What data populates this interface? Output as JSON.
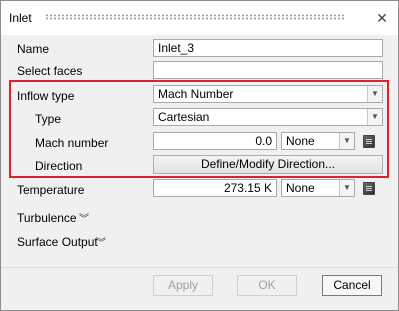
{
  "window": {
    "title": "Inlet"
  },
  "form": {
    "name_label": "Name",
    "name_value": "Inlet_3",
    "select_faces_label": "Select faces",
    "select_faces_value": "",
    "inflow_type_label": "Inflow type",
    "inflow_type_value": "Mach Number",
    "type_label": "Type",
    "type_value": "Cartesian",
    "mach_label": "Mach number",
    "mach_value": "0.0",
    "mach_unit": "None",
    "direction_label": "Direction",
    "direction_button": "Define/Modify Direction...",
    "temperature_label": "Temperature",
    "temperature_value": "273.15 K",
    "temperature_unit": "None"
  },
  "sections": {
    "turbulence_label": "Turbulence",
    "surface_output_label": "Surface Output"
  },
  "buttons": {
    "apply": "Apply",
    "ok": "OK",
    "cancel": "Cancel"
  },
  "icons": {
    "close": "close-icon",
    "dropdown": "chevron-down-icon",
    "expand": "double-chevron-down-icon",
    "unit_picker": "unit-book-icon"
  },
  "colors": {
    "highlight": "#d9232e"
  }
}
